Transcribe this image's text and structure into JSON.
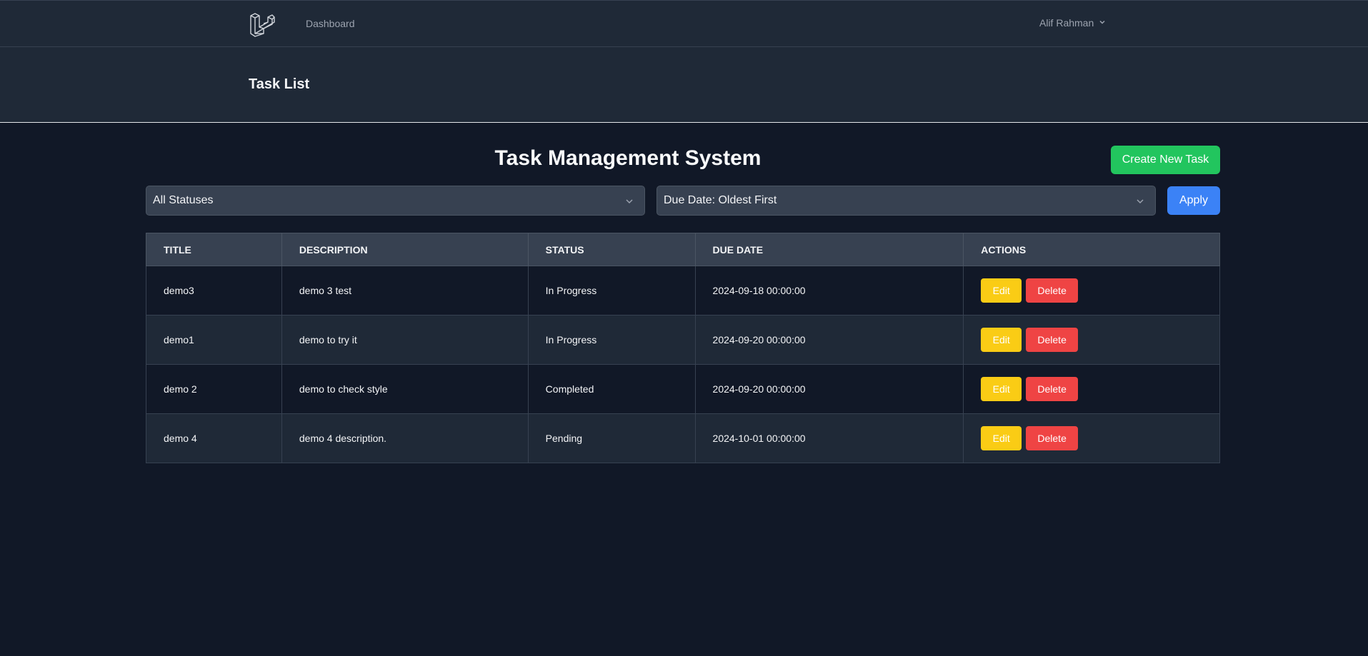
{
  "nav": {
    "logo_icon": "laravel-logo-icon",
    "dashboard_label": "Dashboard",
    "user_name": "Alif Rahman",
    "user_menu_icon": "chevron-down-icon"
  },
  "header": {
    "title": "Task List"
  },
  "main": {
    "title": "Task Management System",
    "create_button": "Create New Task",
    "filters": {
      "status_selected": "All Statuses",
      "sort_selected": "Due Date: Oldest First",
      "apply_label": "Apply"
    },
    "table": {
      "columns": [
        "TITLE",
        "DESCRIPTION",
        "STATUS",
        "DUE DATE",
        "ACTIONS"
      ],
      "rows": [
        {
          "title": "demo3",
          "description": "demo 3 test",
          "status": "In Progress",
          "due_date": "2024-09-18 00:00:00"
        },
        {
          "title": "demo1",
          "description": "demo to try it",
          "status": "In Progress",
          "due_date": "2024-09-20 00:00:00"
        },
        {
          "title": "demo 2",
          "description": "demo to check style",
          "status": "Completed",
          "due_date": "2024-09-20 00:00:00"
        },
        {
          "title": "demo 4",
          "description": "demo 4 description.",
          "status": "Pending",
          "due_date": "2024-10-01 00:00:00"
        }
      ],
      "edit_label": "Edit",
      "delete_label": "Delete"
    }
  },
  "colors": {
    "background": "#111827",
    "panel": "#1f2937",
    "create_button": "#22c55e",
    "apply_button": "#3b82f6",
    "edit_button": "#facc15",
    "delete_button": "#ef4444"
  }
}
